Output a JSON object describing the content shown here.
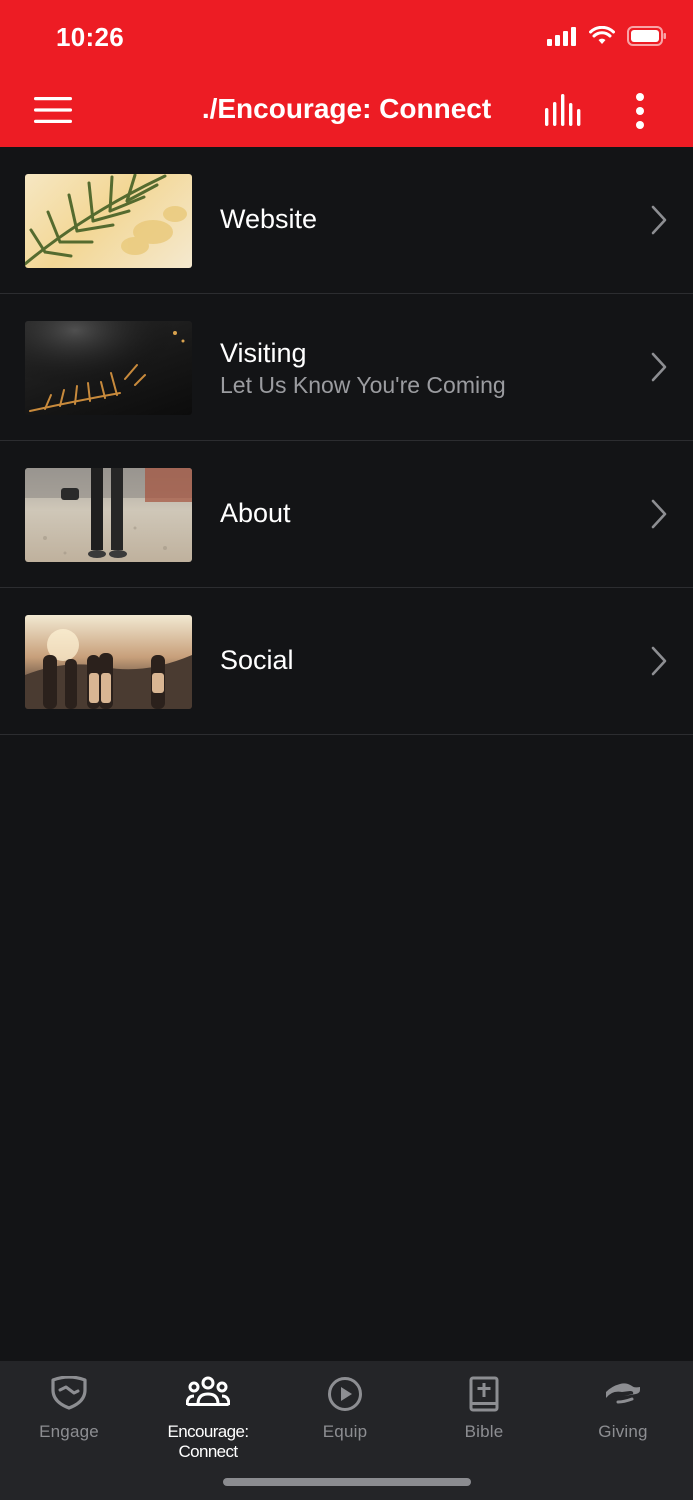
{
  "status_bar": {
    "time": "10:26"
  },
  "header": {
    "title": "./Encourage: Connect"
  },
  "list": {
    "items": [
      {
        "title": "Website",
        "subtitle": ""
      },
      {
        "title": "Visiting",
        "subtitle": "Let Us Know You're Coming"
      },
      {
        "title": "About",
        "subtitle": ""
      },
      {
        "title": "Social",
        "subtitle": ""
      }
    ]
  },
  "tabbar": {
    "tabs": [
      {
        "label": "Engage",
        "icon": "handshake-shield-icon"
      },
      {
        "label": "Encourage: Connect",
        "icon": "people-group-icon"
      },
      {
        "label": "Equip",
        "icon": "play-circle-icon"
      },
      {
        "label": "Bible",
        "icon": "bible-icon"
      },
      {
        "label": "Giving",
        "icon": "giving-hand-icon"
      }
    ],
    "active_index": 1
  },
  "colors": {
    "brand_red": "#ED1C24",
    "background": "#131416",
    "tabbar_bg": "#242528",
    "muted_text": "#9b9ca0"
  }
}
